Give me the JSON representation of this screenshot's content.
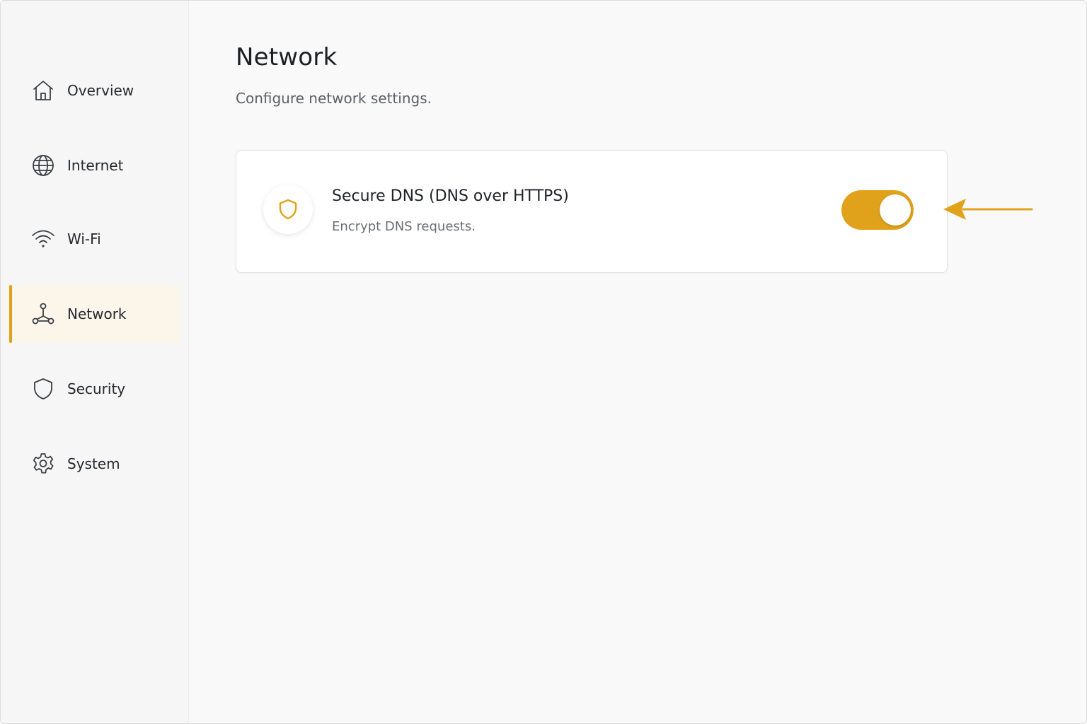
{
  "colors": {
    "accent": "#e0a21a",
    "active_bg": "#fbf5ea",
    "sidebar_bg": "#f6f6f6",
    "main_bg": "#f9f9f9"
  },
  "sidebar": {
    "active": "network",
    "items": [
      {
        "id": "overview",
        "label": "Overview",
        "icon": "home-icon"
      },
      {
        "id": "internet",
        "label": "Internet",
        "icon": "globe-icon"
      },
      {
        "id": "wifi",
        "label": "Wi-Fi",
        "icon": "wifi-icon"
      },
      {
        "id": "network",
        "label": "Network",
        "icon": "network-icon"
      },
      {
        "id": "security",
        "label": "Security",
        "icon": "shield-icon"
      },
      {
        "id": "system",
        "label": "System",
        "icon": "gear-icon"
      }
    ]
  },
  "main": {
    "title": "Network",
    "subtitle": "Configure network settings.",
    "setting": {
      "icon": "shield-icon",
      "title": "Secure DNS (DNS over HTTPS)",
      "description": "Encrypt DNS requests.",
      "enabled": true
    },
    "annotation": {
      "icon": "arrow-left-icon",
      "points_to": "secure-dns-toggle"
    }
  }
}
